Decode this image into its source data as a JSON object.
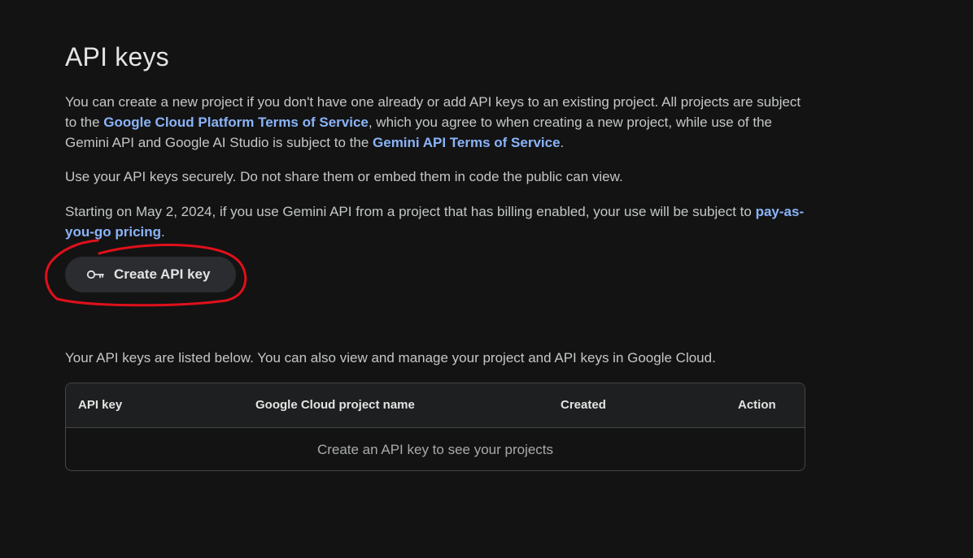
{
  "page": {
    "title": "API keys"
  },
  "intro": {
    "p1_part1": "You can create a new project if you don't have one already or add API keys to an existing project. All projects are subject to the ",
    "p1_link1": "Google Cloud Platform Terms of Service",
    "p1_part2": ", which you agree to when creating a new project, while use of the Gemini API and Google AI Studio is subject to the ",
    "p1_link2": "Gemini API Terms of Service",
    "p1_part3": ".",
    "p2": "Use your API keys securely. Do not share them or embed them in code the public can view.",
    "p3_part1": "Starting on May 2, 2024, if you use Gemini API from a project that has billing enabled, your use will be subject to ",
    "p3_link": "pay-as-you-go pricing",
    "p3_part2": "."
  },
  "create_button": {
    "label": "Create API key",
    "icon": "key-icon"
  },
  "annotation": {
    "color": "#e0101a",
    "shape": "hand-drawn-circle"
  },
  "keys_section": {
    "note": "Your API keys are listed below. You can also view and manage your project and API keys in Google Cloud.",
    "columns": [
      "API key",
      "Google Cloud project name",
      "Created",
      "Action"
    ],
    "empty_message": "Create an API key to see your projects"
  },
  "colors": {
    "background": "#131314",
    "link": "#8ab4f8",
    "button_bg": "#2b2c2f",
    "table_border": "#444746"
  }
}
